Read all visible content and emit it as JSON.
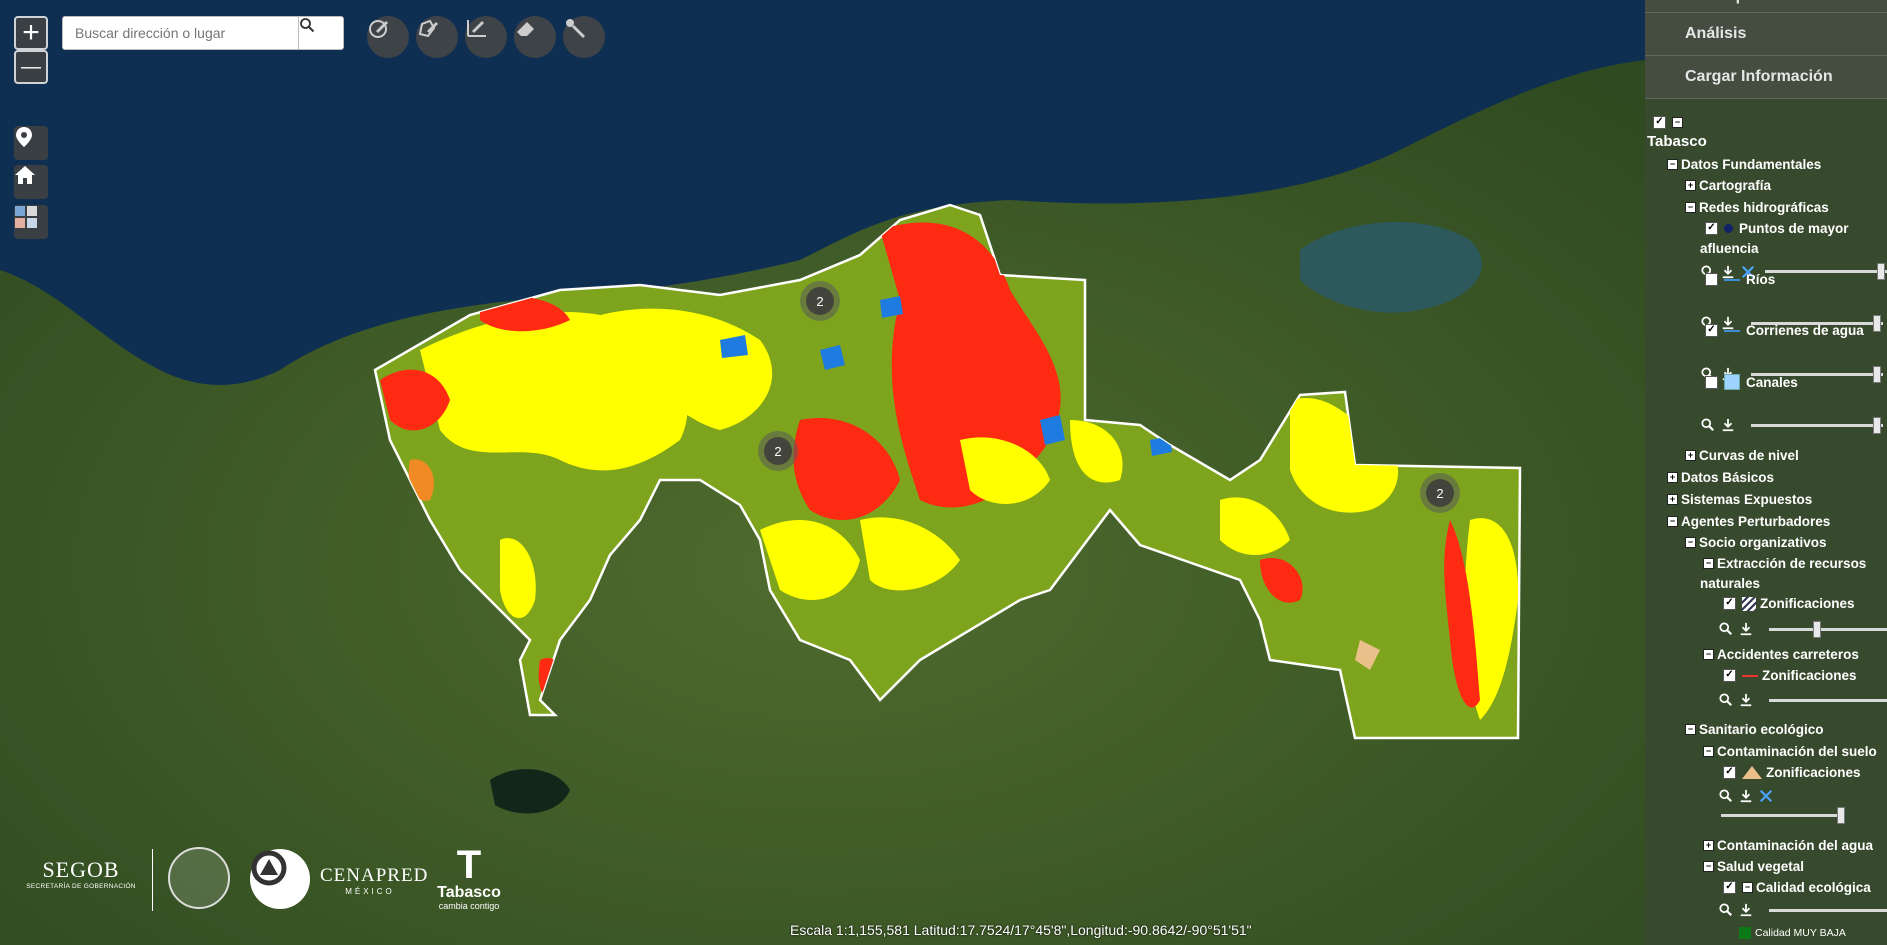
{
  "colors": {
    "red": "#ff2a12",
    "yellow": "#ffff00",
    "green": "#7ea41d",
    "blue": "#1e7be0",
    "orange": "#f08a24",
    "sea": "#0f2f52"
  },
  "search": {
    "placeholder": "Buscar dirección o lugar"
  },
  "controls": {
    "zoom_in": "+",
    "zoom_out": "—"
  },
  "toolbar": [
    "edit-point-icon",
    "edit-polygon-icon",
    "edit-line-icon",
    "eraser-icon",
    "pointer-icon"
  ],
  "clusters": [
    "2",
    "2",
    "2"
  ],
  "scale_text": "Escala 1:1,155,581 Latitud:17.7524/17°45'8\",Longitud:-90.8642/-90°51'51\"",
  "logos": {
    "segob": "SEGOB",
    "segob_sub": "SECRETARÍA DE GOBERNACIÓN",
    "cenapred": "CENAPRED",
    "cenapred_sub": "MÉXICO",
    "tabasco": "Tabasco",
    "tabasco_sub": "cambia contigo",
    "tabasco_letter": "T"
  },
  "menu": [
    "Municipios",
    "Análisis",
    "Cargar Información"
  ],
  "tree": [
    {
      "text": "Tabasco"
    },
    {
      "text": "Datos Fundamentales"
    },
    {
      "text": "Cartografía"
    },
    {
      "text": "Redes hidrográficas"
    },
    {
      "text": "Puntos de mayor"
    },
    {
      "text": "afluencia"
    },
    {
      "text": "Ríos"
    },
    {
      "text": "Corrienes de agua"
    },
    {
      "text": "Canales"
    },
    {
      "text": "Curvas de nivel"
    },
    {
      "text": "Datos Básicos"
    },
    {
      "text": "Sistemas Expuestos"
    },
    {
      "text": "Agentes Perturbadores"
    },
    {
      "text": "Socio organizativos"
    },
    {
      "text": "Extracción de recursos"
    },
    {
      "text": "naturales"
    },
    {
      "text": "Zonificaciones"
    },
    {
      "text": "Accidentes carreteros"
    },
    {
      "text": "Zonificaciones"
    },
    {
      "text": "Sanitario ecológico"
    },
    {
      "text": "Contaminación del suelo"
    },
    {
      "text": "Zonificaciones"
    },
    {
      "text": "Contaminación del agua"
    },
    {
      "text": "Salud vegetal"
    },
    {
      "text": "Calidad ecológica"
    },
    {
      "text": "Calidad MUY BAJA"
    }
  ]
}
